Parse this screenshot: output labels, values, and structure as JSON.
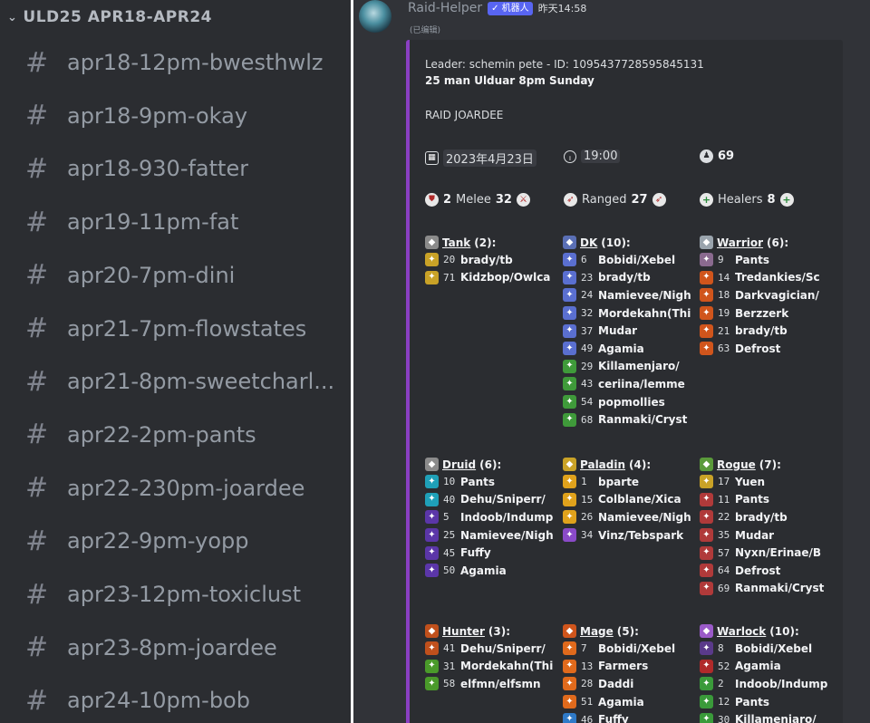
{
  "sidebar": {
    "category": "ULD25 APR18-APR24",
    "channels": [
      "apr18-12pm-bwesthwlz",
      "apr18-9pm-okay",
      "apr18-930-fatter",
      "apr19-11pm-fat",
      "apr20-7pm-dini",
      "apr21-7pm-flowstates",
      "apr21-8pm-sweetcharl...",
      "apr22-2pm-pants",
      "apr22-230pm-joardee",
      "apr22-9pm-yopp",
      "apr23-12pm-toxiclust",
      "apr23-8pm-joardee",
      "apr24-10pm-bob"
    ]
  },
  "message": {
    "username": "Raid-Helper",
    "bot_tag": "✓ 机器人",
    "timestamp": "昨天14:58",
    "edited": "(已编辑)",
    "embed": {
      "leader_line": "Leader: schemin pete - ID: 1095437728595845131",
      "title": "25 man Ulduar 8pm Sunday",
      "description": "RAID JOARDEE",
      "date": "2023年4月23日",
      "time": "19:00",
      "signups": "69",
      "roles": {
        "melee_count": "2",
        "melee_label": "Melee",
        "melee_total": "32",
        "ranged_label": "Ranged",
        "ranged_total": "27",
        "healers_label": "Healers",
        "healers_total": "8"
      },
      "classes": [
        {
          "name": "Tank",
          "count": "(2):",
          "icon_color": "#8b8b8b",
          "members": [
            [
              "20",
              "brady/tb",
              "#c9a227"
            ],
            [
              "71",
              "Kidzbop/Owlca",
              "#c9a227"
            ]
          ]
        },
        {
          "name": "DK",
          "count": "(10):",
          "icon_color": "#5a6fb5",
          "members": [
            [
              "6",
              "Bobidi/Xebel",
              "#5a6fd0"
            ],
            [
              "23",
              "brady/tb",
              "#5a6fd0"
            ],
            [
              "24",
              "Namievee/Nigh",
              "#5a6fd0"
            ],
            [
              "32",
              "Mordekahn(Thi",
              "#5a6fd0"
            ],
            [
              "37",
              "Mudar",
              "#5a6fd0"
            ],
            [
              "49",
              "Agamia",
              "#5a6fd0"
            ],
            [
              "29",
              "Killamenjaro/",
              "#3f9a3a"
            ],
            [
              "43",
              "ceriina/lemme",
              "#3f9a3a"
            ],
            [
              "54",
              "popmollies",
              "#3f9a3a"
            ],
            [
              "68",
              "Ranmaki/Cryst",
              "#3f9a3a"
            ]
          ]
        },
        {
          "name": "Warrior",
          "count": "(6):",
          "icon_color": "#9aa4ad",
          "members": [
            [
              "9",
              "Pants",
              "#8a6a8f"
            ],
            [
              "14",
              "Tredankies/Sc",
              "#d0551c"
            ],
            [
              "18",
              "Darkvagician/",
              "#d0551c"
            ],
            [
              "19",
              "Berzzerk",
              "#d0551c"
            ],
            [
              "21",
              "brady/tb",
              "#d0551c"
            ],
            [
              "63",
              "Defrost",
              "#d0551c"
            ]
          ]
        },
        {
          "name": "Druid",
          "count": "(6):",
          "icon_color": "#8b8b8b",
          "members": [
            [
              "10",
              "Pants",
              "#1fa0b8"
            ],
            [
              "40",
              "Dehu/Sniperr/",
              "#1fa0b8"
            ],
            [
              "5",
              "Indoob/Indump",
              "#5b36a8"
            ],
            [
              "25",
              "Namievee/Nigh",
              "#5b36a8"
            ],
            [
              "45",
              "Fuffy",
              "#5b36a8"
            ],
            [
              "50",
              "Agamia",
              "#5b36a8"
            ]
          ]
        },
        {
          "name": "Paladin",
          "count": "(4):",
          "icon_color": "#c9a227",
          "members": [
            [
              "1",
              "bparte",
              "#e0a21c"
            ],
            [
              "15",
              "Colblane/Xica",
              "#e0a21c"
            ],
            [
              "26",
              "Namievee/Nigh",
              "#e0a21c"
            ],
            [
              "34",
              "Vinz/Tebspark",
              "#8a4ac8"
            ]
          ]
        },
        {
          "name": "Rogue",
          "count": "(7):",
          "icon_color": "#5a9a3a",
          "members": [
            [
              "17",
              "Yuen",
              "#c9a227"
            ],
            [
              "11",
              "Pants",
              "#b03a3a"
            ],
            [
              "22",
              "brady/tb",
              "#b03a3a"
            ],
            [
              "35",
              "Mudar",
              "#b03a3a"
            ],
            [
              "57",
              "Nyxn/Erinae/B",
              "#b03a3a"
            ],
            [
              "64",
              "Defrost",
              "#b03a3a"
            ],
            [
              "69",
              "Ranmaki/Cryst",
              "#b03a3a"
            ]
          ]
        },
        {
          "name": "Hunter",
          "count": "(3):",
          "icon_color": "#c0501c",
          "members": [
            [
              "41",
              "Dehu/Sniperr/",
              "#c0501c"
            ],
            [
              "31",
              "Mordekahn(Thi",
              "#4a9a2a"
            ],
            [
              "58",
              "elfmn/elfsmn",
              "#4a9a2a"
            ]
          ]
        },
        {
          "name": "Mage",
          "count": "(5):",
          "icon_color": "#d0551c",
          "members": [
            [
              "7",
              "Bobidi/Xebel",
              "#e06a1c"
            ],
            [
              "13",
              "Farmers",
              "#e06a1c"
            ],
            [
              "28",
              "Daddi",
              "#e06a1c"
            ],
            [
              "51",
              "Agamia",
              "#e06a1c"
            ],
            [
              "46",
              "Fuffy",
              "#2f7ac8"
            ]
          ]
        },
        {
          "name": "Warlock",
          "count": "(10):",
          "icon_color": "#9a5ac8",
          "members": [
            [
              "8",
              "Bobidi/Xebel",
              "#5a3a8a"
            ],
            [
              "52",
              "Agamia",
              "#b02a2a"
            ],
            [
              "2",
              "Indoob/Indump",
              "#3a9a3a"
            ],
            [
              "12",
              "Pants",
              "#3a9a3a"
            ],
            [
              "30",
              "Killamenjaro/",
              "#3a9a3a"
            ]
          ]
        }
      ]
    }
  }
}
